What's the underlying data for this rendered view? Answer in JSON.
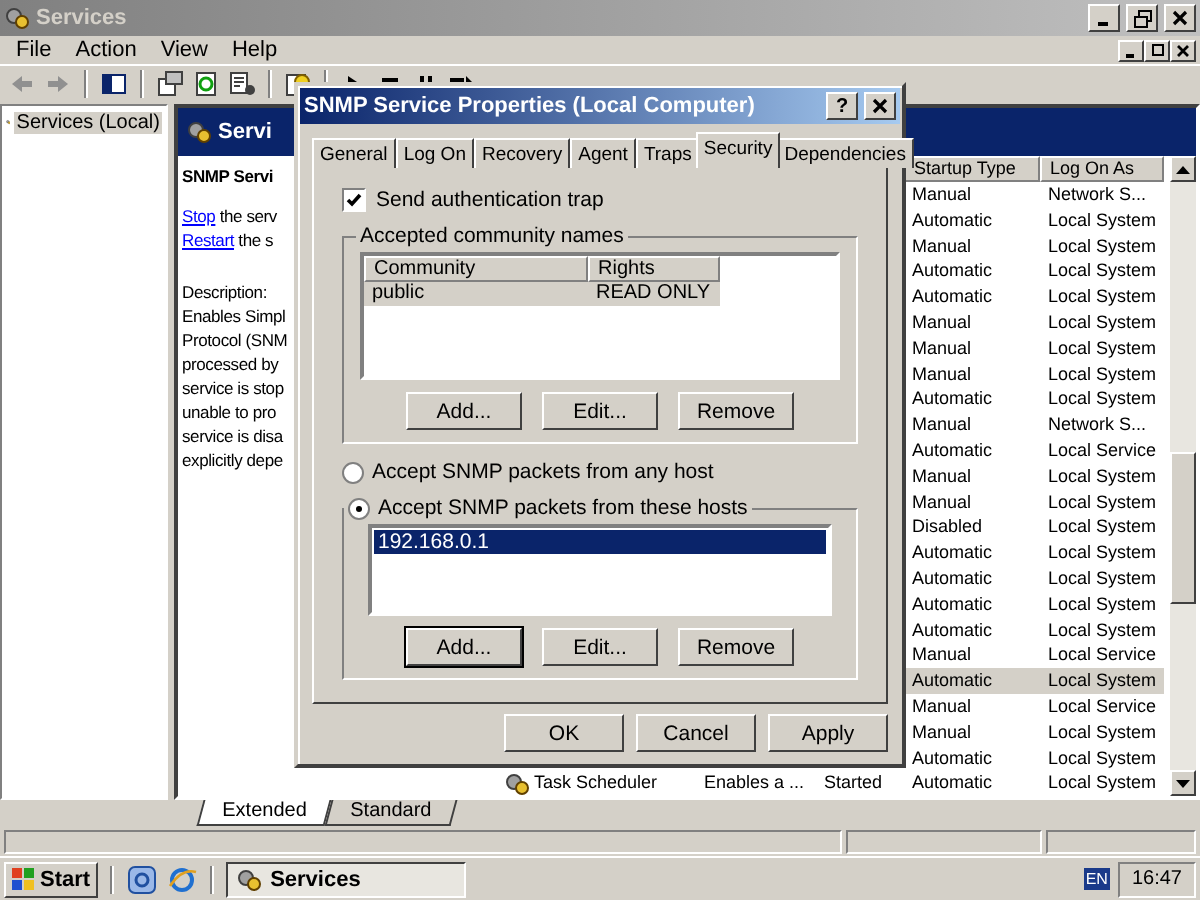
{
  "window": {
    "title": "Services",
    "active": false
  },
  "menu": [
    "File",
    "Action",
    "View",
    "Help"
  ],
  "tree": [
    {
      "label": "Services (Local)",
      "selected": true
    }
  ],
  "header": {
    "title": "Servi"
  },
  "detail": {
    "service_name": "SNMP Servi",
    "actions": [
      {
        "link": "Stop",
        "text": " the serv"
      },
      {
        "link": "Restart",
        "text": " the s"
      }
    ],
    "description_label": "Description:",
    "description_lines": [
      "Enables Simpl",
      "Protocol (SNM",
      "processed by",
      "service is stop",
      "unable to pro",
      "service is disa",
      "explicitly depe"
    ]
  },
  "services": {
    "columns": [
      {
        "label": "Startup Type"
      },
      {
        "label": "Log On As"
      }
    ],
    "rows": [
      {
        "startup": "Manual",
        "logon": "Network S...",
        "selected": false
      },
      {
        "startup": "Automatic",
        "logon": "Local System",
        "selected": false
      },
      {
        "startup": "Manual",
        "logon": "Local System",
        "selected": false
      },
      {
        "startup": "Automatic",
        "logon": "Local System",
        "selected": false
      },
      {
        "startup": "Automatic",
        "logon": "Local System",
        "selected": false
      },
      {
        "startup": "Manual",
        "logon": "Local System",
        "selected": false
      },
      {
        "startup": "Manual",
        "logon": "Local System",
        "selected": false
      },
      {
        "startup": "Manual",
        "logon": "Local System",
        "selected": false
      },
      {
        "startup": "Automatic",
        "logon": "Local System",
        "selected": false
      },
      {
        "startup": "Manual",
        "logon": "Network S...",
        "selected": false
      },
      {
        "startup": "Automatic",
        "logon": "Local Service",
        "selected": false
      },
      {
        "startup": "Manual",
        "logon": "Local System",
        "selected": false
      },
      {
        "startup": "Manual",
        "logon": "Local System",
        "selected": false
      },
      {
        "startup": "Disabled",
        "logon": "Local System",
        "selected": false
      },
      {
        "startup": "Automatic",
        "logon": "Local System",
        "selected": false
      },
      {
        "startup": "Automatic",
        "logon": "Local System",
        "selected": false
      },
      {
        "startup": "Automatic",
        "logon": "Local System",
        "selected": false
      },
      {
        "startup": "Automatic",
        "logon": "Local System",
        "selected": false
      },
      {
        "startup": "Manual",
        "logon": "Local Service",
        "selected": false
      },
      {
        "startup": "Automatic",
        "logon": "Local System",
        "selected": true
      },
      {
        "startup": "Manual",
        "logon": "Local Service",
        "selected": false
      },
      {
        "startup": "Manual",
        "logon": "Local System",
        "selected": false
      },
      {
        "startup": "Automatic",
        "logon": "Local System",
        "selected": false
      },
      {
        "name": "Task Scheduler",
        "description": "Enables a ...",
        "status": "Started",
        "startup": "Automatic",
        "logon": "Local System",
        "selected": false
      }
    ]
  },
  "view_tabs": [
    {
      "label": "Extended",
      "selected": true
    },
    {
      "label": "Standard",
      "selected": false
    }
  ],
  "dialog": {
    "title": "SNMP Service Properties (Local Computer)",
    "help_button": "?",
    "tabs": [
      {
        "label": "General",
        "selected": false
      },
      {
        "label": "Log On",
        "selected": false
      },
      {
        "label": "Recovery",
        "selected": false
      },
      {
        "label": "Agent",
        "selected": false
      },
      {
        "label": "Traps",
        "selected": false
      },
      {
        "label": "Security",
        "selected": true
      },
      {
        "label": "Dependencies",
        "selected": false
      }
    ],
    "auth_trap": {
      "label": "Send authentication trap",
      "checked": true
    },
    "community_group": {
      "title": "Accepted community names",
      "columns": [
        "Community",
        "Rights"
      ],
      "rows": [
        {
          "community": "public",
          "rights": "READ ONLY",
          "selected": true
        }
      ],
      "buttons": [
        "Add...",
        "Edit...",
        "Remove"
      ]
    },
    "host_options": [
      {
        "label": "Accept SNMP packets from any host",
        "selected": false
      },
      {
        "label": "Accept SNMP packets from these hosts",
        "selected": true
      }
    ],
    "hosts": {
      "items": [
        {
          "label": "192.168.0.1",
          "selected": true
        }
      ],
      "buttons": [
        {
          "label": "Add...",
          "focused": true
        },
        {
          "label": "Edit...",
          "focused": false
        },
        {
          "label": "Remove",
          "focused": false
        }
      ]
    },
    "buttons": [
      "OK",
      "Cancel",
      "Apply"
    ]
  },
  "taskbar": {
    "start": "Start",
    "tasks": [
      {
        "label": "Services",
        "selected": true
      }
    ],
    "language": "EN",
    "clock": "16:47"
  }
}
